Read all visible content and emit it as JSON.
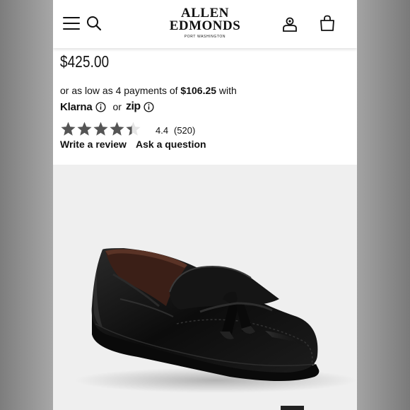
{
  "header": {
    "brand_line1": "ALLEN",
    "brand_line2": "EDMONDS",
    "brand_tagline": "PORT WASHINGTON",
    "icons": [
      "menu-icon",
      "search-icon",
      "account-icon",
      "shopping-bag-icon"
    ]
  },
  "product": {
    "price": "$425.00",
    "installments_prefix": "or as low as 4 payments of",
    "installments_amount": "$106.25",
    "installments_suffix": "with",
    "klarna_label": "Klarna",
    "or_label": "or",
    "zip_label": "zip"
  },
  "rating": {
    "stars": 4.4,
    "value": "4.4",
    "count": "(520)",
    "write_review": "Write a review",
    "ask_question": "Ask a question"
  },
  "colors": {
    "accent_zip": "#aa8fff",
    "text": "#111111",
    "image_background": "#efefef"
  }
}
